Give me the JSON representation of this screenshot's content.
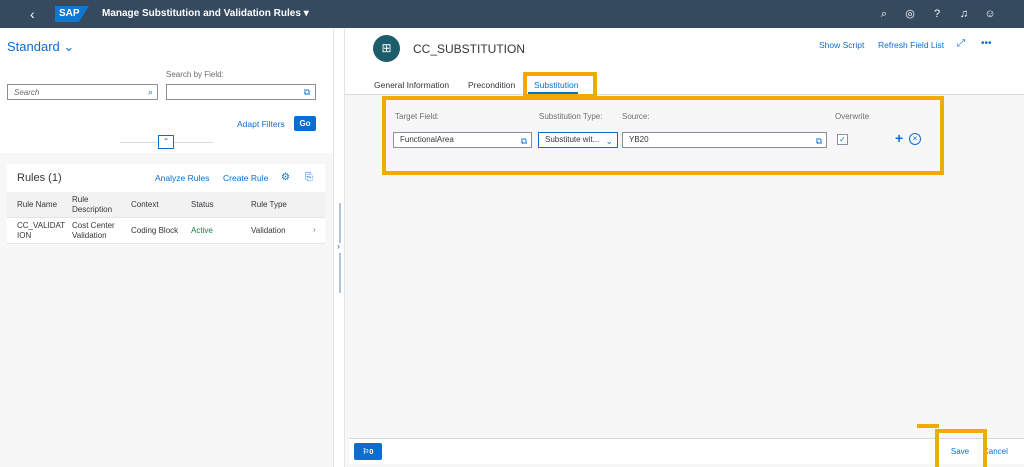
{
  "shell": {
    "back_icon": "chevron-left-icon",
    "logo": "SAP",
    "title": "Manage Substitution and Validation Rules",
    "title_caret": "▾",
    "icons": [
      "search-icon",
      "co-pilot-icon",
      "help-icon",
      "notifications-icon",
      "user-icon"
    ]
  },
  "filterbar": {
    "variant": "Standard",
    "search_placeholder": "Search",
    "search_by_field_label": "Search by Field:",
    "search_by_field_value": "",
    "adapt_filters": "Adapt Filters",
    "go": "Go"
  },
  "rules": {
    "title": "Rules (1)",
    "analyze": "Analyze Rules",
    "create": "Create Rule",
    "columns": [
      "Rule Name",
      "Rule Description",
      "Context",
      "Status",
      "Rule Type"
    ],
    "rows": [
      {
        "name": "CC_VALIDATION",
        "description": "Cost Center Validation",
        "context": "Coding Block",
        "status": "Active",
        "type": "Validation"
      }
    ]
  },
  "object": {
    "title": "CC_SUBSTITUTION",
    "show_script": "Show Script",
    "refresh": "Refresh Field List",
    "tabs": [
      "General Information",
      "Precondition",
      "Substitution"
    ],
    "selected_tab": "Substitution"
  },
  "substitution": {
    "target_label": "Target Field:",
    "type_label": "Substitution Type:",
    "source_label": "Source:",
    "overwrite_label": "Overwrite",
    "target_value": "FunctionalArea",
    "type_value": "Substitute wit...",
    "source_value": "YB20",
    "overwrite_checked": true
  },
  "footer": {
    "messages_count": "0",
    "save": "Save",
    "cancel": "Cancel"
  },
  "colors": {
    "shell": "#354a5f",
    "accent": "#0a6ed1",
    "highlight": "#f0ab00",
    "active": "#107e3e"
  }
}
